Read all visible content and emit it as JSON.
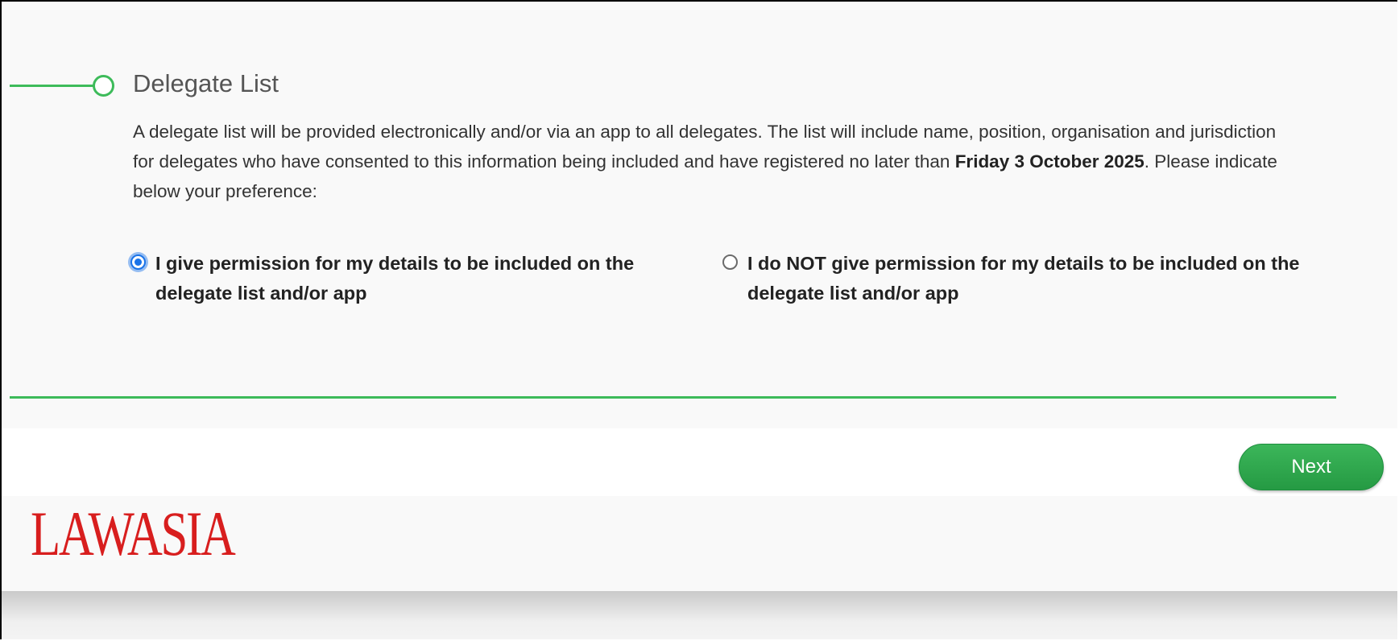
{
  "section": {
    "title": "Delegate List",
    "description_part1": "A delegate list will be provided electronically and/or via an app to all delegates. The list will include name, position, organisation and jurisdiction for delegates who have consented to this information being included and have registered no later than ",
    "description_bold": "Friday 3 October 2025",
    "description_part2": ". Please indicate below your preference:"
  },
  "options": [
    {
      "label": "I give permission for my details to be included on the delegate list and/or app",
      "checked": true
    },
    {
      "label": "I do NOT give permission for my details to be included on the delegate list and/or app",
      "checked": false
    }
  ],
  "navigation": {
    "next_label": "Next"
  },
  "footer": {
    "logo_text": "LAWASIA"
  },
  "colors": {
    "accent_green": "#3dbb5a",
    "logo_red": "#d81e1e",
    "radio_blue": "#1a73e8"
  }
}
